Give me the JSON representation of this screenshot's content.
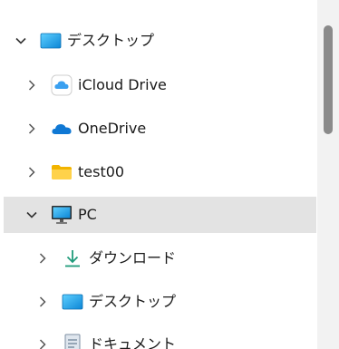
{
  "nav_tree": {
    "items": [
      {
        "label": "デスクトップ",
        "icon": "desktop-icon",
        "expanded": true
      },
      {
        "label": "iCloud Drive",
        "icon": "icloud-icon",
        "expanded": false
      },
      {
        "label": "OneDrive",
        "icon": "onedrive-icon",
        "expanded": false
      },
      {
        "label": "test00",
        "icon": "folder-icon",
        "expanded": false
      },
      {
        "label": "PC",
        "icon": "pc-icon",
        "expanded": true,
        "selected": true
      },
      {
        "label": "ダウンロード",
        "icon": "download-icon",
        "expanded": false
      },
      {
        "label": "デスクトップ",
        "icon": "desktop-icon",
        "expanded": false
      },
      {
        "label": "ドキュメント",
        "icon": "documents-icon",
        "expanded": false
      }
    ]
  },
  "colors": {
    "selected_row": "#e3e3e3",
    "scrollbar_track": "#f2f2f2",
    "scrollbar_thumb": "#8a8a8a",
    "download_accent": "#1f9b7a",
    "onedrive_blue": "#0f78d4",
    "desktop_blue": "#1aa3e8"
  }
}
